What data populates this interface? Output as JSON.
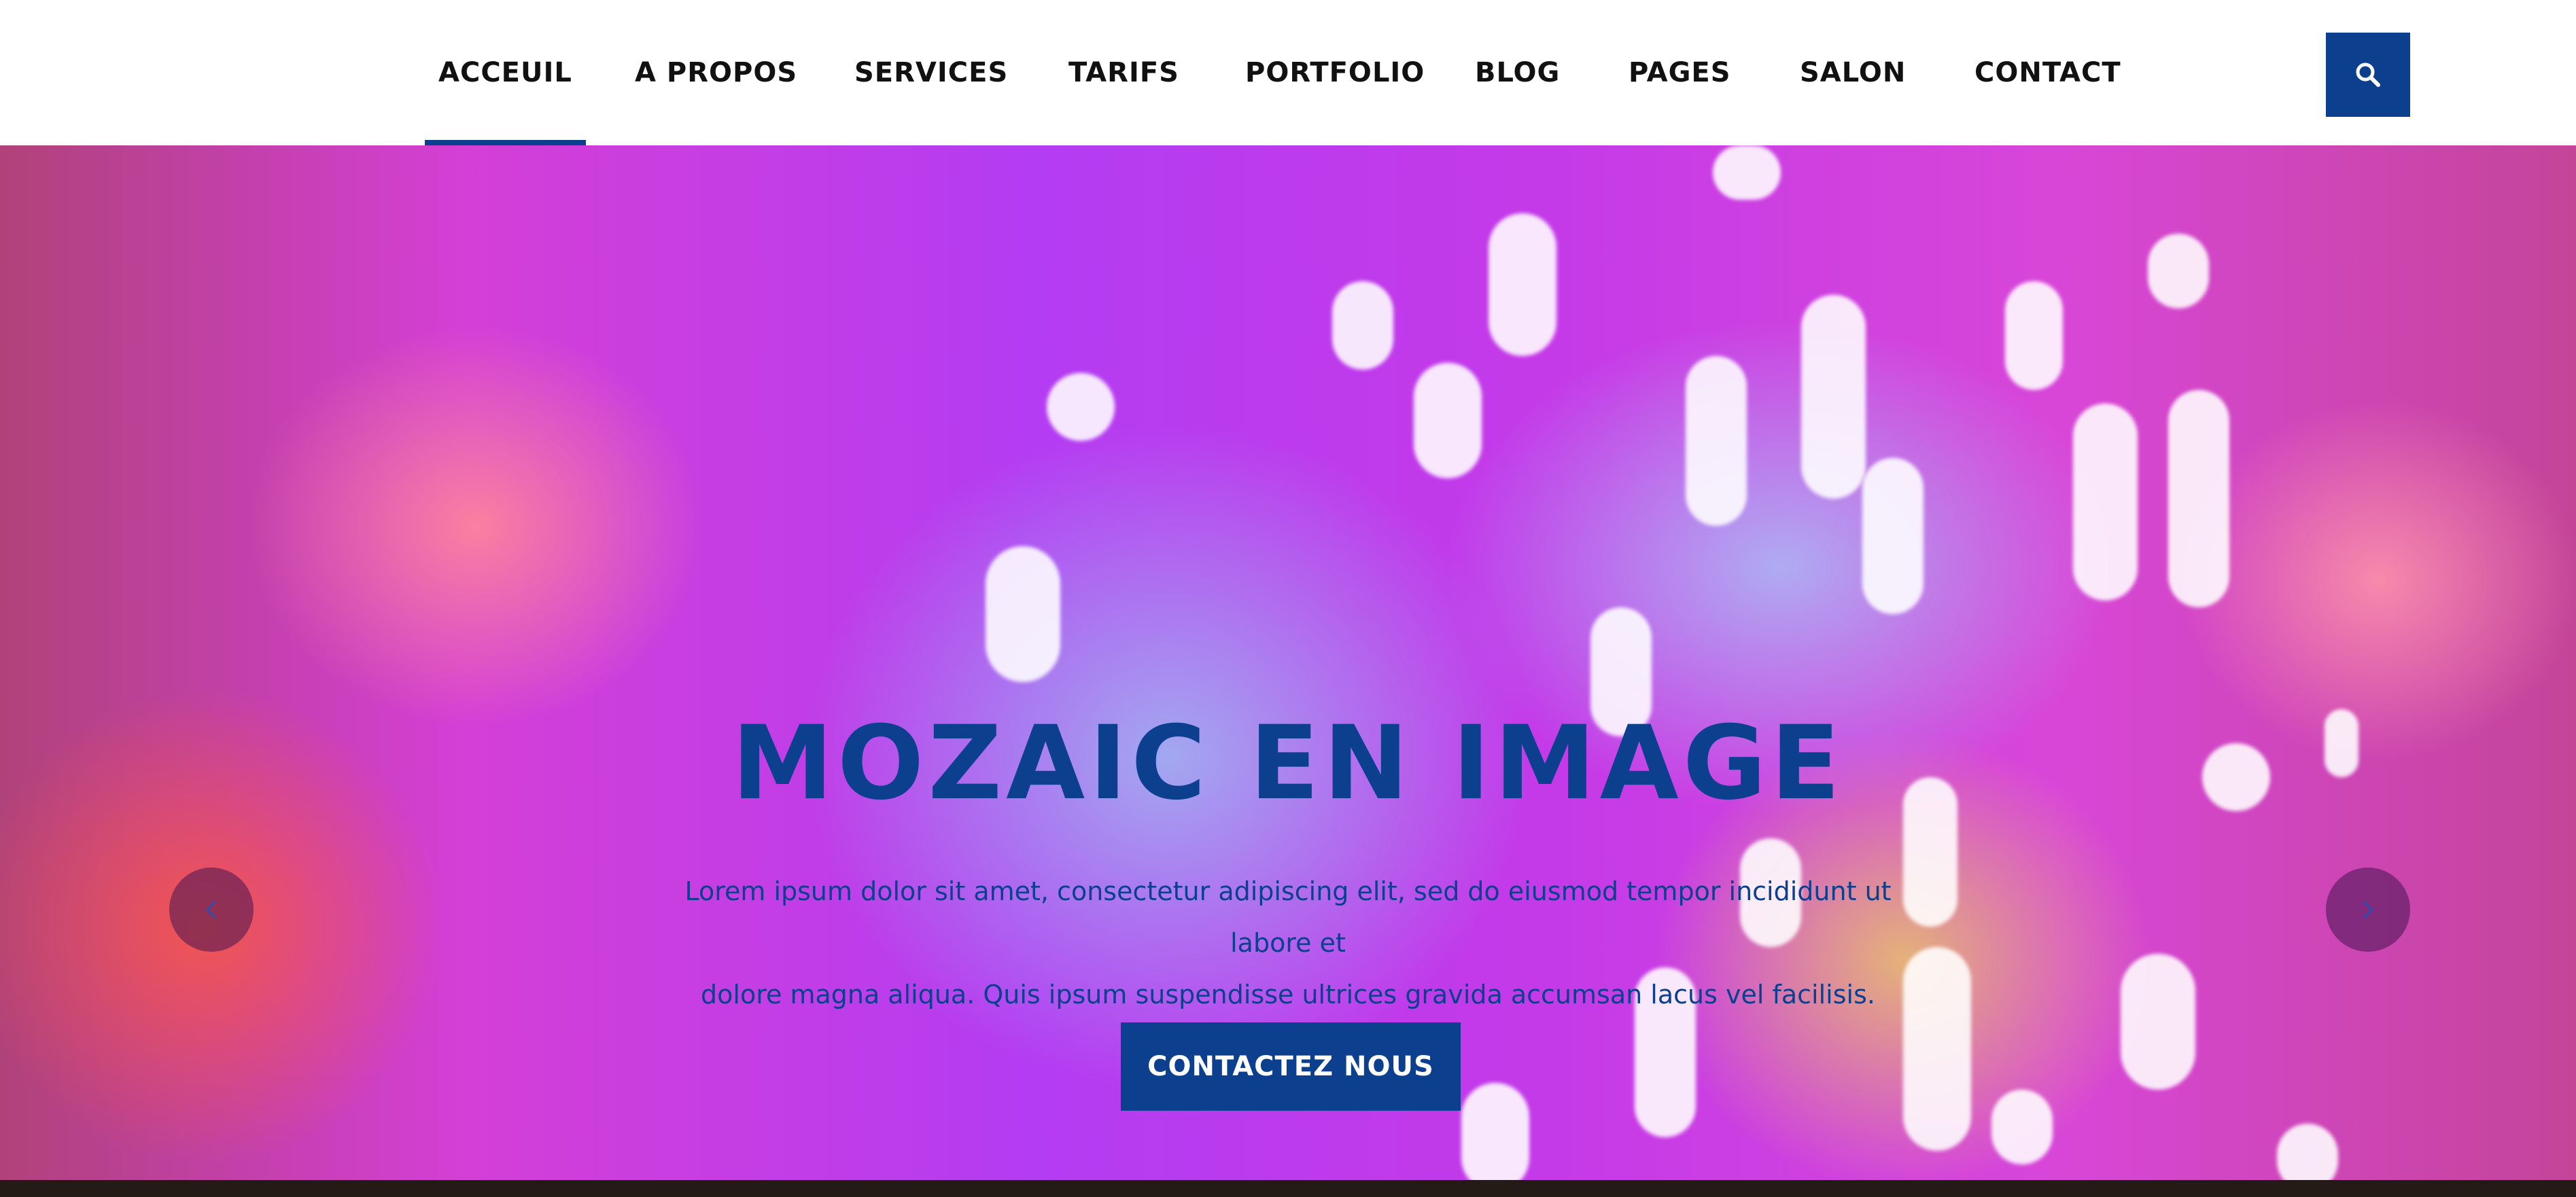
{
  "nav": {
    "items": [
      {
        "label": "ACCEUIL",
        "active": true
      },
      {
        "label": "A PROPOS",
        "active": false
      },
      {
        "label": "SERVICES",
        "active": false
      },
      {
        "label": "TARIFS",
        "active": false
      },
      {
        "label": "PORTFOLIO",
        "active": false
      },
      {
        "label": "BLOG",
        "active": false
      },
      {
        "label": "PAGES",
        "active": false
      },
      {
        "label": "SALON",
        "active": false
      },
      {
        "label": "CONTACT",
        "active": false
      }
    ],
    "search_icon": "search-icon"
  },
  "hero": {
    "title": "MOZAIC EN IMAGE",
    "text_line1": "Lorem ipsum dolor sit amet, consectetur adipiscing elit, sed do eiusmod tempor incididunt ut labore et",
    "text_line2": "dolore magna aliqua. Quis ipsum suspendisse ultrices gravida accumsan lacus vel facilisis.",
    "cta_label": "CONTACTEZ NOUS",
    "prev_icon": "chevron-left-icon",
    "next_icon": "chevron-right-icon"
  },
  "colors": {
    "accent": "#0d3f8f",
    "nav_text": "#111111",
    "footer_bar": "#241a16"
  }
}
